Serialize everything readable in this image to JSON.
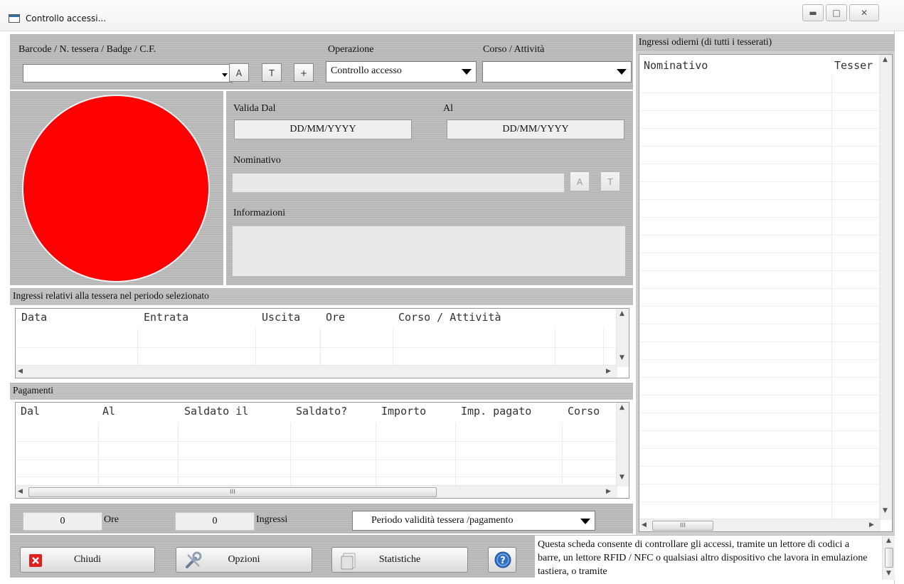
{
  "window": {
    "title": "Controllo accessi..."
  },
  "search": {
    "label": "Barcode / N. tessera / Badge / C.F.",
    "value": "",
    "btn_a": "A",
    "btn_t": "T",
    "btn_plus": "+"
  },
  "operazione": {
    "label": "Operazione",
    "value": "Controllo accesso"
  },
  "corso": {
    "label": "Corso / Attività",
    "value": ""
  },
  "status_color": "#ff0000",
  "valid": {
    "from_label": "Valida Dal",
    "to_label": "Al",
    "from_value": "DD/MM/YYYY",
    "to_value": "DD/MM/YYYY"
  },
  "nominativo": {
    "label": "Nominativo",
    "value": "",
    "btn_a": "A",
    "btn_t": "T"
  },
  "informazioni": {
    "label": "Informazioni",
    "value": ""
  },
  "ingressi": {
    "title": "Ingressi relativi alla tessera nel periodo selezionato",
    "columns": [
      "Data",
      "Entrata",
      "Uscita",
      "Ore",
      "Corso / Attività"
    ]
  },
  "pagamenti": {
    "title": "Pagamenti",
    "columns": [
      "Dal",
      "Al",
      "Saldato il",
      "Saldato?",
      "Importo",
      "Imp. pagato",
      "Corso"
    ],
    "hscroll_glyph": "III"
  },
  "summary": {
    "ore_value": "0",
    "ore_label": "Ore",
    "ingressi_value": "0",
    "ingressi_label": "Ingressi",
    "period_value": "Periodo validità tessera /pagamento"
  },
  "odierni": {
    "title": "Ingressi odierni (di tutti i tesserati)",
    "columns": [
      "Nominativo",
      "Tessera"
    ],
    "hscroll_glyph": "III"
  },
  "buttons": {
    "close": "Chiudi",
    "options": "Opzioni",
    "stats": "Statistiche"
  },
  "help_text": "Questa scheda consente di controllare gli accessi, tramite un lettore di codici a barre, un lettore RFID / NFC o qualsiasi altro dispositivo che lavora in emulazione tastiera, o tramite"
}
